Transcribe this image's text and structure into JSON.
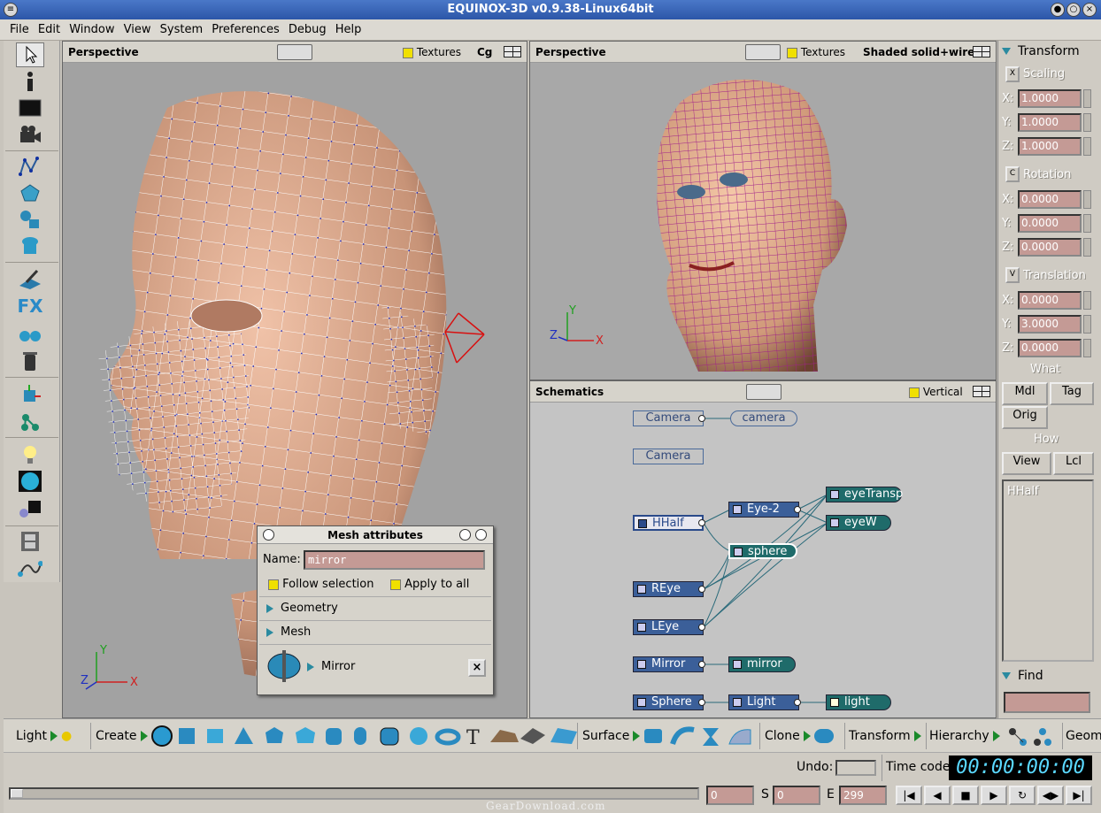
{
  "window": {
    "title": "EQUINOX-3D v0.9.38-Linux64bit"
  },
  "menu": [
    "File",
    "Edit",
    "Window",
    "View",
    "System",
    "Preferences",
    "Debug",
    "Help"
  ],
  "viewport1": {
    "title": "Perspective",
    "textures_label": "Textures",
    "render_mode": "Cg",
    "axis_labels": [
      "Y",
      "Z",
      "X"
    ]
  },
  "viewport2": {
    "title": "Perspective",
    "textures_label": "Textures",
    "render_mode": "Shaded solid+wire",
    "axis_labels": [
      "Y",
      "Z",
      "X"
    ]
  },
  "schematics": {
    "title": "Schematics",
    "vertical_label": "Vertical",
    "nodes": [
      {
        "label": "Camera",
        "kind": "outline"
      },
      {
        "label": "camera",
        "kind": "outline"
      },
      {
        "label": "Camera",
        "kind": "outline"
      },
      {
        "label": "HHalf",
        "kind": "blue"
      },
      {
        "label": "Eye-2",
        "kind": "blue"
      },
      {
        "label": "eyeTransp",
        "kind": "teal"
      },
      {
        "label": "eyeW",
        "kind": "teal"
      },
      {
        "label": "sphere",
        "kind": "teal"
      },
      {
        "label": "REye",
        "kind": "blue"
      },
      {
        "label": "LEye",
        "kind": "blue"
      },
      {
        "label": "Mirror",
        "kind": "blue"
      },
      {
        "label": "mirror",
        "kind": "teal"
      },
      {
        "label": "Sphere",
        "kind": "blue"
      },
      {
        "label": "Light",
        "kind": "blue"
      },
      {
        "label": "light",
        "kind": "teal"
      }
    ]
  },
  "transform": {
    "title": "Transform",
    "scaling": {
      "key": "X",
      "label": "Scaling",
      "x": "1.0000",
      "y": "1.0000",
      "z": "1.0000"
    },
    "rotation": {
      "key": "C",
      "label": "Rotation",
      "x": "0.0000",
      "y": "0.0000",
      "z": "0.0000"
    },
    "translation": {
      "key": "V",
      "label": "Translation",
      "x": "0.0000",
      "y": "3.0000",
      "z": "0.0000"
    },
    "axis_x": "X:",
    "axis_y": "Y:",
    "axis_z": "Z:",
    "what_label": "What",
    "what_buttons": [
      "Mdl",
      "Tag",
      "Orig"
    ],
    "how_label": "How",
    "how_buttons": [
      "View",
      "Lcl"
    ],
    "selected_item": "HHalf",
    "find_label": "Find",
    "find_value": ""
  },
  "dialog": {
    "title": "Mesh attributes",
    "name_label": "Name:",
    "name_value": "mirror",
    "follow_label": "Follow selection",
    "apply_label": "Apply to all",
    "geometry_label": "Geometry",
    "mesh_label": "Mesh",
    "mirror_label": "Mirror"
  },
  "bottom": {
    "light": "Light",
    "create": "Create",
    "surface": "Surface",
    "clone": "Clone",
    "transform": "Transform",
    "hierarchy": "Hierarchy",
    "geom": "Geom"
  },
  "status": {
    "undo_label": "Undo:",
    "timecode_label": "Time code",
    "timecode": "00:00:00:00"
  },
  "timeline": {
    "current": "0",
    "s_label": "S",
    "start": "0",
    "e_label": "E",
    "end": "299"
  },
  "watermark": "GearDownload.com"
}
